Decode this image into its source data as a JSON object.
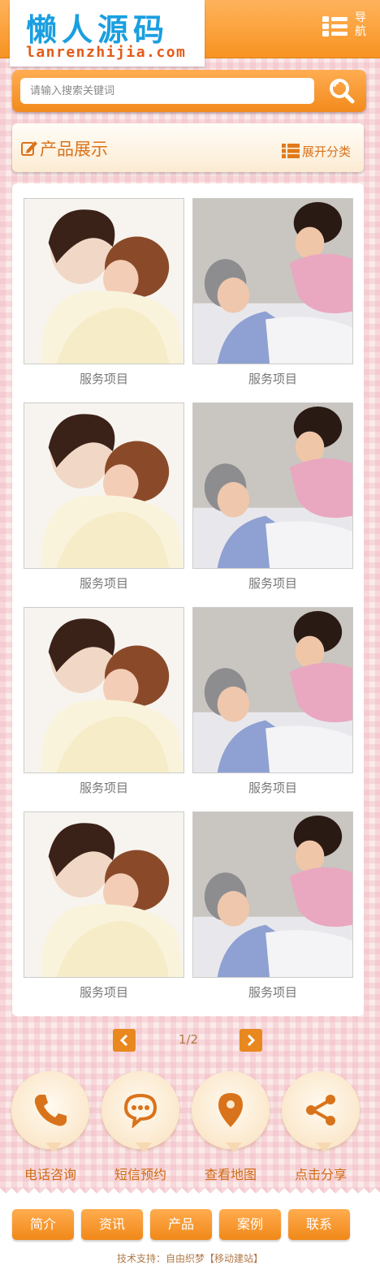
{
  "header": {
    "logo_cn": "懒人源码",
    "logo_en": "lanrenzhijia.com",
    "nav_label": "导航"
  },
  "search": {
    "placeholder": "请输入搜索关键词"
  },
  "category": {
    "title": "产品展示",
    "expand_label": "展开分类"
  },
  "products": [
    {
      "caption": "服务项目",
      "image": "mother-baby-photo"
    },
    {
      "caption": "服务项目",
      "image": "elderly-care-photo"
    },
    {
      "caption": "服务项目",
      "image": "mother-baby-photo"
    },
    {
      "caption": "服务项目",
      "image": "elderly-care-photo"
    },
    {
      "caption": "服务项目",
      "image": "mother-baby-photo"
    },
    {
      "caption": "服务项目",
      "image": "elderly-care-photo"
    },
    {
      "caption": "服务项目",
      "image": "mother-baby-photo"
    },
    {
      "caption": "服务项目",
      "image": "elderly-care-photo"
    }
  ],
  "pager": {
    "info": "1/2"
  },
  "actions": [
    {
      "label": "电话咨询",
      "icon": "phone-icon"
    },
    {
      "label": "短信预约",
      "icon": "message-icon"
    },
    {
      "label": "查看地图",
      "icon": "map-pin-icon"
    },
    {
      "label": "点击分享",
      "icon": "share-icon"
    }
  ],
  "footer": {
    "nav": [
      "简介",
      "资讯",
      "产品",
      "案例",
      "联系"
    ],
    "copyright": "技术支持：自由织梦【移动建站】"
  },
  "colors": {
    "accent": "#f79321",
    "brand_blue": "#1a9fe0",
    "text_orange": "#cf6a12"
  }
}
